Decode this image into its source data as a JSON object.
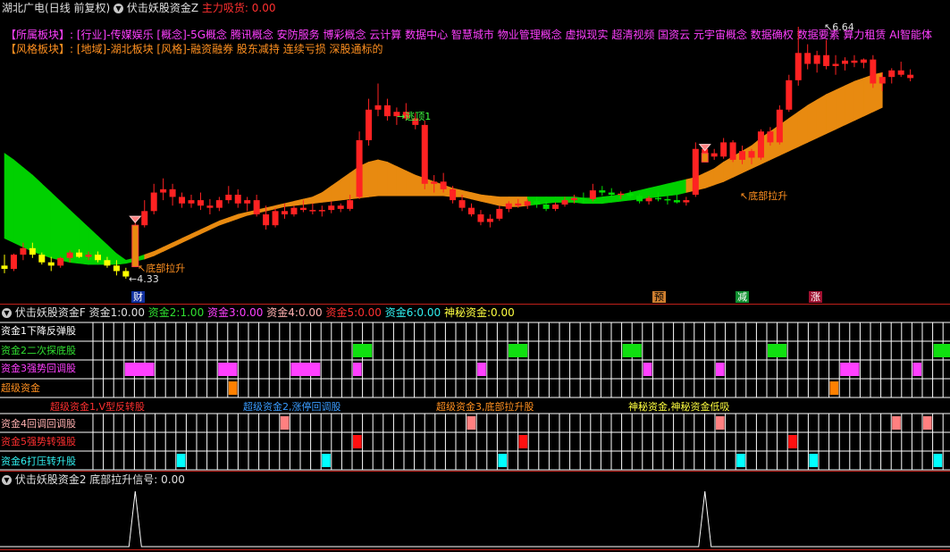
{
  "header": {
    "stock": "湖北广电",
    "period": "(日线 前复权)",
    "indicator": "伏击妖股资金Z",
    "main_flow_label": "主力吸货:",
    "main_flow_value": "0.00"
  },
  "sectors": {
    "label1": "【所属板块】:",
    "text1": "[行业]-传媒娱乐 [概念]-5G概念 腾讯概念 安防服务 博彩概念 云计算 数据中心 智慧城市 物业管理概念 虚拟现实 超清视频 国资云 元宇宙概念 数据确权 数据要素 算力租赁 AI智能体",
    "label2": "【风格板块】:",
    "text2": "[地域]-湖北板块 [风格]-融资融券 股东减持 连续亏损 深股通标的"
  },
  "chart_annotations": {
    "top_escape": "逃顶1",
    "high_price": "6.64",
    "low_price": "4.33",
    "bottom_rise": "底部拉升"
  },
  "markers": {
    "cai": "财",
    "yu": "预",
    "jian": "减",
    "zhang": "涨"
  },
  "panel2": {
    "title": "伏击妖股资金F",
    "fund1_label": "资金1:",
    "fund1_value": "0.00",
    "fund2_label": "资金2:",
    "fund2_value": "1.00",
    "fund3_label": "资金3:",
    "fund3_value": "0.00",
    "fund4_label": "资金4:",
    "fund4_value": "0.00",
    "fund5_label": "资金5:",
    "fund5_value": "0.00",
    "fund6_label": "资金6:",
    "fund6_value": "0.00",
    "mystery_label": "神秘资金:",
    "mystery_value": "0.00",
    "rows": [
      "资金1下降反弹股",
      "资金2二次探底股",
      "资金3强势回调股",
      "超级资金",
      "资金4回调回调股",
      "资金5强势转强股",
      "资金6打压转升股"
    ],
    "super_labels": [
      "超级资金1,V型反转股",
      "超级资金2,涨停回调股",
      "超级资金3,底部拉升股",
      "神秘资金,神秘资金低吸"
    ]
  },
  "panel3": {
    "title": "伏击妖股资金2",
    "signal_label": "底部拉升信号:",
    "signal_value": "0.00"
  },
  "colors": {
    "up": "#ff2222",
    "down_early": "#ffff00",
    "down_late": "#00e000",
    "band_green": "#00d000",
    "band_orange": "#e88a10",
    "grid_line": "#c0201a",
    "magenta": "#ff40ff",
    "cyan": "#00ffff",
    "fund_orange": "#ff8000",
    "fund_pink": "#ff8080"
  },
  "candles": [
    [
      4.45,
      4.55,
      4.38,
      4.42
    ],
    [
      4.42,
      4.56,
      4.4,
      4.55
    ],
    [
      4.55,
      4.66,
      4.5,
      4.61
    ],
    [
      4.61,
      4.66,
      4.52,
      4.55
    ],
    [
      4.55,
      4.57,
      4.46,
      4.48
    ],
    [
      4.48,
      4.53,
      4.4,
      4.45
    ],
    [
      4.45,
      4.53,
      4.43,
      4.52
    ],
    [
      4.52,
      4.59,
      4.48,
      4.57
    ],
    [
      4.57,
      4.6,
      4.52,
      4.53
    ],
    [
      4.53,
      4.58,
      4.5,
      4.55
    ],
    [
      4.55,
      4.58,
      4.48,
      4.5
    ],
    [
      4.5,
      4.53,
      4.43,
      4.45
    ],
    [
      4.45,
      4.5,
      4.36,
      4.4
    ],
    [
      4.4,
      4.43,
      4.33,
      4.35
    ],
    [
      4.45,
      4.85,
      4.44,
      4.82
    ],
    [
      4.82,
      5.05,
      4.8,
      4.95
    ],
    [
      4.95,
      5.2,
      4.92,
      5.12
    ],
    [
      5.12,
      5.25,
      5.05,
      5.15
    ],
    [
      5.15,
      5.2,
      5.0,
      5.08
    ],
    [
      5.08,
      5.12,
      4.98,
      5.02
    ],
    [
      5.02,
      5.1,
      4.98,
      5.05
    ],
    [
      5.05,
      5.12,
      4.96,
      5.0
    ],
    [
      5.0,
      5.06,
      4.92,
      4.98
    ],
    [
      4.98,
      5.08,
      4.95,
      5.05
    ],
    [
      5.05,
      5.18,
      5.02,
      5.1
    ],
    [
      5.1,
      5.15,
      4.98,
      5.02
    ],
    [
      5.02,
      5.08,
      4.95,
      5.05
    ],
    [
      5.05,
      5.1,
      4.9,
      4.92
    ],
    [
      4.92,
      5.0,
      4.78,
      4.82
    ],
    [
      4.82,
      4.98,
      4.8,
      4.95
    ],
    [
      4.95,
      5.02,
      4.88,
      4.92
    ],
    [
      4.92,
      5.0,
      4.9,
      4.98
    ],
    [
      4.98,
      5.05,
      4.94,
      4.96
    ],
    [
      4.96,
      5.02,
      4.92,
      4.95
    ],
    [
      4.95,
      5.0,
      4.9,
      4.96
    ],
    [
      4.96,
      5.04,
      4.93,
      5.0
    ],
    [
      5.0,
      5.02,
      4.94,
      4.97
    ],
    [
      4.97,
      5.1,
      4.95,
      5.05
    ],
    [
      5.08,
      5.68,
      5.06,
      5.6
    ],
    [
      5.6,
      5.98,
      5.55,
      5.88
    ],
    [
      5.88,
      6.12,
      5.82,
      5.92
    ],
    [
      5.92,
      5.98,
      5.78,
      5.82
    ],
    [
      5.82,
      5.9,
      5.74,
      5.86
    ],
    [
      5.86,
      5.94,
      5.78,
      5.8
    ],
    [
      5.8,
      5.85,
      5.7,
      5.74
    ],
    [
      5.74,
      5.78,
      5.15,
      5.2
    ],
    [
      5.2,
      5.28,
      5.12,
      5.22
    ],
    [
      5.22,
      5.3,
      5.12,
      5.15
    ],
    [
      5.15,
      5.18,
      5.02,
      5.05
    ],
    [
      5.05,
      5.1,
      4.95,
      4.98
    ],
    [
      4.98,
      5.02,
      4.9,
      4.92
    ],
    [
      4.92,
      4.96,
      4.82,
      4.85
    ],
    [
      4.85,
      4.92,
      4.8,
      4.88
    ],
    [
      4.88,
      5.0,
      4.86,
      4.97
    ],
    [
      4.97,
      5.04,
      4.94,
      5.02
    ],
    [
      5.02,
      5.06,
      4.98,
      5.0
    ],
    [
      5.0,
      5.06,
      4.97,
      5.04
    ],
    [
      5.04,
      5.07,
      4.98,
      5.01
    ],
    [
      5.01,
      5.04,
      4.95,
      4.97
    ],
    [
      4.97,
      5.03,
      4.95,
      5.01
    ],
    [
      5.01,
      5.08,
      4.99,
      5.05
    ],
    [
      5.05,
      5.1,
      5.02,
      5.07
    ],
    [
      5.07,
      5.12,
      5.03,
      5.06
    ],
    [
      5.06,
      5.2,
      5.04,
      5.14
    ],
    [
      5.14,
      5.18,
      5.09,
      5.12
    ],
    [
      5.12,
      5.16,
      5.08,
      5.1
    ],
    [
      5.1,
      5.13,
      5.06,
      5.11
    ],
    [
      5.11,
      5.14,
      5.07,
      5.09
    ],
    [
      5.09,
      5.11,
      5.02,
      5.04
    ],
    [
      5.04,
      5.09,
      5.01,
      5.07
    ],
    [
      5.07,
      5.12,
      5.04,
      5.06
    ],
    [
      5.06,
      5.09,
      5.01,
      5.05
    ],
    [
      5.05,
      5.1,
      5.02,
      5.03
    ],
    [
      5.03,
      5.08,
      5.0,
      5.05
    ],
    [
      5.1,
      5.58,
      5.08,
      5.52
    ],
    [
      5.52,
      5.55,
      5.4,
      5.48
    ],
    [
      5.48,
      5.52,
      5.42,
      5.45
    ],
    [
      5.45,
      5.62,
      5.43,
      5.58
    ],
    [
      5.58,
      5.6,
      5.4,
      5.42
    ],
    [
      5.42,
      5.55,
      5.38,
      5.5
    ],
    [
      5.5,
      5.52,
      5.38,
      5.44
    ],
    [
      5.44,
      5.7,
      5.42,
      5.68
    ],
    [
      5.68,
      5.72,
      5.55,
      5.58
    ],
    [
      5.58,
      5.92,
      5.56,
      5.88
    ],
    [
      5.88,
      6.2,
      5.86,
      6.15
    ],
    [
      6.15,
      6.64,
      6.1,
      6.4
    ],
    [
      6.4,
      6.48,
      6.25,
      6.3
    ],
    [
      6.3,
      6.42,
      6.22,
      6.38
    ],
    [
      6.38,
      6.52,
      6.25,
      6.28
    ],
    [
      6.28,
      6.38,
      6.2,
      6.3
    ],
    [
      6.3,
      6.36,
      6.24,
      6.33
    ],
    [
      6.33,
      6.38,
      6.27,
      6.31
    ],
    [
      6.31,
      6.35,
      6.26,
      6.34
    ],
    [
      6.34,
      6.38,
      6.08,
      6.12
    ],
    [
      6.12,
      6.22,
      6.05,
      6.18
    ],
    [
      6.18,
      6.26,
      6.12,
      6.24
    ],
    [
      6.24,
      6.32,
      6.18,
      6.2
    ],
    [
      6.2,
      6.25,
      6.14,
      6.17
    ]
  ],
  "band_top": [
    5.48,
    5.42,
    5.35,
    5.28,
    5.2,
    5.12,
    5.04,
    4.96,
    4.88,
    4.8,
    4.72,
    4.64,
    4.56,
    4.5,
    4.52,
    4.55,
    4.58,
    4.62,
    4.66,
    4.7,
    4.74,
    4.78,
    4.82,
    4.86,
    4.89,
    4.92,
    4.94,
    4.96,
    4.98,
    5.0,
    5.02,
    5.04,
    5.06,
    5.08,
    5.12,
    5.18,
    5.24,
    5.3,
    5.36,
    5.4,
    5.42,
    5.4,
    5.36,
    5.32,
    5.28,
    5.25,
    5.22,
    5.19,
    5.16,
    5.14,
    5.12,
    5.1,
    5.09,
    5.08,
    5.08,
    5.08,
    5.08,
    5.08,
    5.08,
    5.08,
    5.08,
    5.08,
    5.07,
    5.07,
    5.08,
    5.09,
    5.1,
    5.12,
    5.14,
    5.16,
    5.18,
    5.2,
    5.22,
    5.24,
    5.26,
    5.3,
    5.34,
    5.4,
    5.45,
    5.5,
    5.55,
    5.62,
    5.68,
    5.74,
    5.8,
    5.86,
    5.92,
    5.97,
    6.02,
    6.06,
    6.1,
    6.14,
    6.17,
    6.2,
    6.22
  ],
  "band_bot": [
    4.7,
    4.66,
    4.62,
    4.58,
    4.55,
    4.52,
    4.5,
    4.48,
    4.47,
    4.46,
    4.46,
    4.46,
    4.46,
    4.47,
    4.49,
    4.51,
    4.54,
    4.58,
    4.62,
    4.66,
    4.7,
    4.74,
    4.78,
    4.82,
    4.85,
    4.88,
    4.91,
    4.93,
    4.95,
    4.97,
    4.99,
    5.0,
    5.01,
    5.02,
    5.03,
    5.04,
    5.05,
    5.06,
    5.07,
    5.08,
    5.09,
    5.09,
    5.09,
    5.09,
    5.09,
    5.09,
    5.09,
    5.09,
    5.08,
    5.08,
    5.06,
    5.04,
    5.02,
    5.0,
    4.99,
    4.99,
    5.0,
    5.01,
    5.02,
    5.03,
    5.03,
    5.03,
    5.02,
    5.02,
    5.02,
    5.03,
    5.04,
    5.05,
    5.06,
    5.07,
    5.08,
    5.09,
    5.1,
    5.12,
    5.14,
    5.16,
    5.19,
    5.22,
    5.26,
    5.3,
    5.34,
    5.38,
    5.42,
    5.46,
    5.5,
    5.54,
    5.58,
    5.62,
    5.66,
    5.7,
    5.74,
    5.78,
    5.82,
    5.86,
    5.9
  ],
  "green_ranges": [
    [
      0,
      14
    ],
    [
      56,
      72
    ]
  ],
  "signal_spikes": [
    14,
    75
  ],
  "fund_cells": {
    "row1": [],
    "row2": [
      [
        25,
        26
      ],
      [
        40,
        41
      ],
      [
        51,
        52
      ],
      [
        65,
        66
      ],
      [
        81,
        82
      ]
    ],
    "row3": [
      [
        3,
        5
      ],
      [
        12,
        13
      ],
      [
        19,
        21
      ],
      [
        25,
        25
      ],
      [
        37,
        37
      ],
      [
        53,
        53
      ],
      [
        60,
        60
      ],
      [
        72,
        73
      ],
      [
        79,
        79
      ]
    ],
    "row4": [
      [
        13,
        13
      ],
      [
        71,
        71
      ]
    ],
    "row5": [
      [
        18,
        18
      ],
      [
        36,
        36
      ],
      [
        60,
        60
      ],
      [
        77,
        77
      ],
      [
        80,
        80
      ]
    ],
    "row6": [
      [
        25,
        25
      ],
      [
        41,
        41
      ],
      [
        67,
        67
      ],
      [
        83,
        83
      ]
    ],
    "row7": [
      [
        8,
        8
      ],
      [
        22,
        22
      ],
      [
        39,
        39
      ],
      [
        62,
        62
      ],
      [
        69,
        69
      ],
      [
        81,
        81
      ]
    ]
  }
}
